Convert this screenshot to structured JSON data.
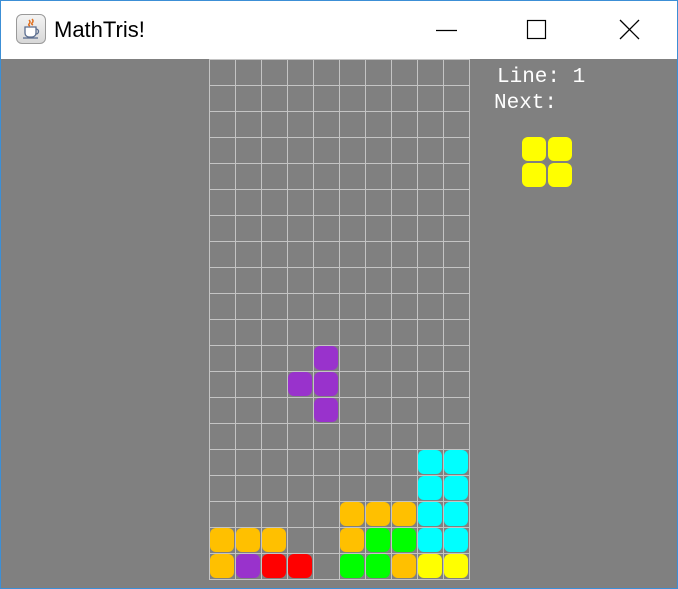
{
  "window": {
    "title": "MathTris!",
    "icon": "java-cup-icon",
    "controls": [
      "minimize-icon",
      "maximize-icon",
      "close-icon"
    ]
  },
  "hud": {
    "line_label": "Line:",
    "line_value": "1",
    "next_label": "Next:"
  },
  "colors": {
    "background": "#808080",
    "grid": "#c4c4c4",
    "yellow": "#ffff00",
    "orange": "#ffc000",
    "purple": "#9932cc",
    "red": "#ff0000",
    "green": "#00ff00",
    "cyan": "#00ffff"
  },
  "board": {
    "columns": 10,
    "rows": 20,
    "active_piece": {
      "shape": "T",
      "color": "purple",
      "cells": [
        [
          4,
          11
        ],
        [
          3,
          12
        ],
        [
          4,
          12
        ],
        [
          4,
          13
        ]
      ]
    },
    "settled_cells": [
      [
        8,
        15,
        "cyan"
      ],
      [
        9,
        15,
        "cyan"
      ],
      [
        8,
        16,
        "cyan"
      ],
      [
        9,
        16,
        "cyan"
      ],
      [
        5,
        17,
        "orange"
      ],
      [
        6,
        17,
        "orange"
      ],
      [
        7,
        17,
        "orange"
      ],
      [
        8,
        17,
        "cyan"
      ],
      [
        9,
        17,
        "cyan"
      ],
      [
        0,
        18,
        "orange"
      ],
      [
        1,
        18,
        "orange"
      ],
      [
        2,
        18,
        "orange"
      ],
      [
        5,
        18,
        "orange"
      ],
      [
        6,
        18,
        "green"
      ],
      [
        7,
        18,
        "green"
      ],
      [
        8,
        18,
        "cyan"
      ],
      [
        9,
        18,
        "cyan"
      ],
      [
        0,
        19,
        "orange"
      ],
      [
        1,
        19,
        "purple"
      ],
      [
        2,
        19,
        "red"
      ],
      [
        3,
        19,
        "red"
      ],
      [
        5,
        19,
        "green"
      ],
      [
        6,
        19,
        "green"
      ],
      [
        7,
        19,
        "orange"
      ],
      [
        8,
        19,
        "yellow"
      ],
      [
        9,
        19,
        "yellow"
      ]
    ]
  },
  "next_piece": {
    "shape": "O",
    "color": "yellow",
    "cells": [
      [
        0,
        0
      ],
      [
        1,
        0
      ],
      [
        0,
        1
      ],
      [
        1,
        1
      ]
    ]
  }
}
